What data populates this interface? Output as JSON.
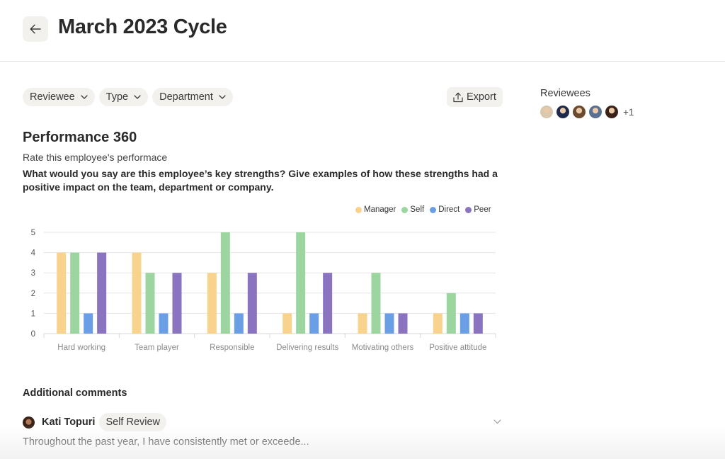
{
  "header": {
    "back_icon": "arrow-left-icon",
    "title": "March 2023 Cycle"
  },
  "filters": [
    {
      "label": "Reviewee",
      "icon": "chevron-down-icon"
    },
    {
      "label": "Type",
      "icon": "chevron-down-icon"
    },
    {
      "label": "Department",
      "icon": "chevron-down-icon"
    }
  ],
  "export": {
    "label": "Export",
    "icon": "upload-icon"
  },
  "reviewees": {
    "label": "Reviewees",
    "avatars": [
      {
        "name": "avatar-1",
        "color": "#d9c7ae"
      },
      {
        "name": "avatar-2",
        "color": "#1f2a4a"
      },
      {
        "name": "avatar-3",
        "color": "#6b4a2e"
      },
      {
        "name": "avatar-4",
        "color": "#5a7090"
      },
      {
        "name": "avatar-5",
        "color": "#3a2218"
      }
    ],
    "more": "+1"
  },
  "section": {
    "title": "Performance 360",
    "subtitle": "Rate this employee's performace",
    "question": "What would you say are this employee’s key strengths? Give examples of how these strengths had a positive impact on the team, department or company."
  },
  "chart_data": {
    "type": "bar",
    "title": "",
    "xlabel": "",
    "ylabel": "",
    "ylim": [
      0,
      5
    ],
    "yticks": [
      0,
      1,
      2,
      3,
      4,
      5
    ],
    "grid": true,
    "legend_position": "top-right",
    "categories": [
      "Hard working",
      "Team player",
      "Responsible",
      "Delivering results",
      "Motivating others",
      "Positive attitude"
    ],
    "series": [
      {
        "name": "Manager",
        "color": "#f7d38e",
        "values": [
          4,
          4,
          3,
          1,
          1,
          1
        ]
      },
      {
        "name": "Self",
        "color": "#9dd5a0",
        "values": [
          4,
          3,
          5,
          5,
          3,
          2
        ]
      },
      {
        "name": "Direct",
        "color": "#6a9fe6",
        "values": [
          1,
          1,
          1,
          1,
          1,
          1
        ]
      },
      {
        "name": "Peer",
        "color": "#8a73bf",
        "values": [
          4,
          3,
          3,
          3,
          1,
          1
        ]
      }
    ]
  },
  "comments": {
    "title": "Additional comments",
    "items": [
      {
        "author": "Kati Topuri",
        "badge": "Self Review",
        "avatar_color": "#3a2218",
        "text": "Throughout the past year, I have consistently met or exceede..."
      }
    ]
  }
}
